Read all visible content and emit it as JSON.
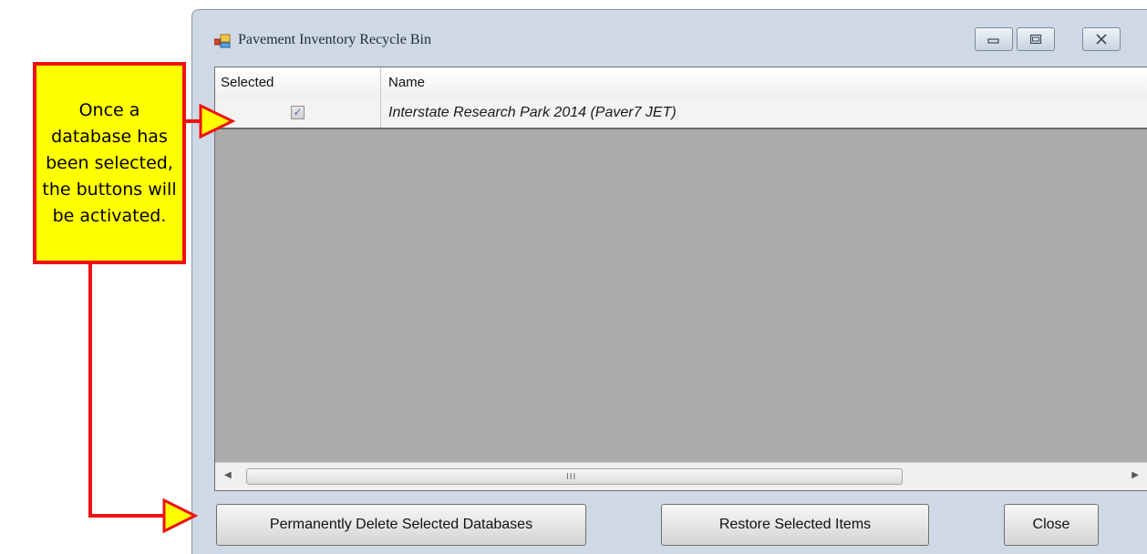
{
  "window": {
    "title": "Pavement Inventory Recycle Bin",
    "controls": {
      "minimize_icon": "minimize-icon",
      "maximize_icon": "maximize-icon",
      "close_icon": "close-icon"
    }
  },
  "grid": {
    "columns": [
      "Selected",
      "Name"
    ],
    "rows": [
      {
        "selected": true,
        "name": "Interstate Research Park 2014 (Paver7 JET)"
      }
    ],
    "scrollbar_grip": "III"
  },
  "buttons": {
    "delete": "Permanently Delete Selected Databases",
    "restore": "Restore Selected Items",
    "close": "Close"
  },
  "annotation": {
    "text": "Once a database has been selected, the buttons will be activated.",
    "fill_color": "#ffff00",
    "border_color": "#ee1111"
  }
}
